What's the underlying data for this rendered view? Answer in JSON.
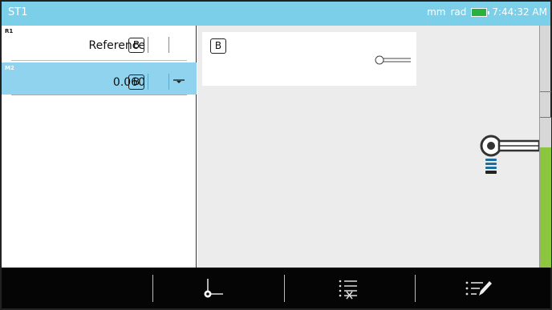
{
  "titlebar": {
    "title": "ST1",
    "units": "mm",
    "angle_units": "rad",
    "time": "7:44:32 AM"
  },
  "measurements": [
    {
      "id": "R1",
      "value": "Reference",
      "base": "B"
    },
    {
      "id": "M2",
      "value": "0.060",
      "base": "B",
      "selected": true
    }
  ],
  "card": {
    "base": "B"
  },
  "colors": {
    "titlebar": "#7ccfe9",
    "selected_row": "#8fd3ef",
    "battery": "#27b23d",
    "scale_green": "#8cc63f",
    "probe_blue": "#1d6fa0",
    "toolbar": "#050505"
  },
  "toolbar": {
    "buttons": [
      "datum-point-icon",
      "list-clear-icon",
      "list-edit-icon"
    ]
  }
}
